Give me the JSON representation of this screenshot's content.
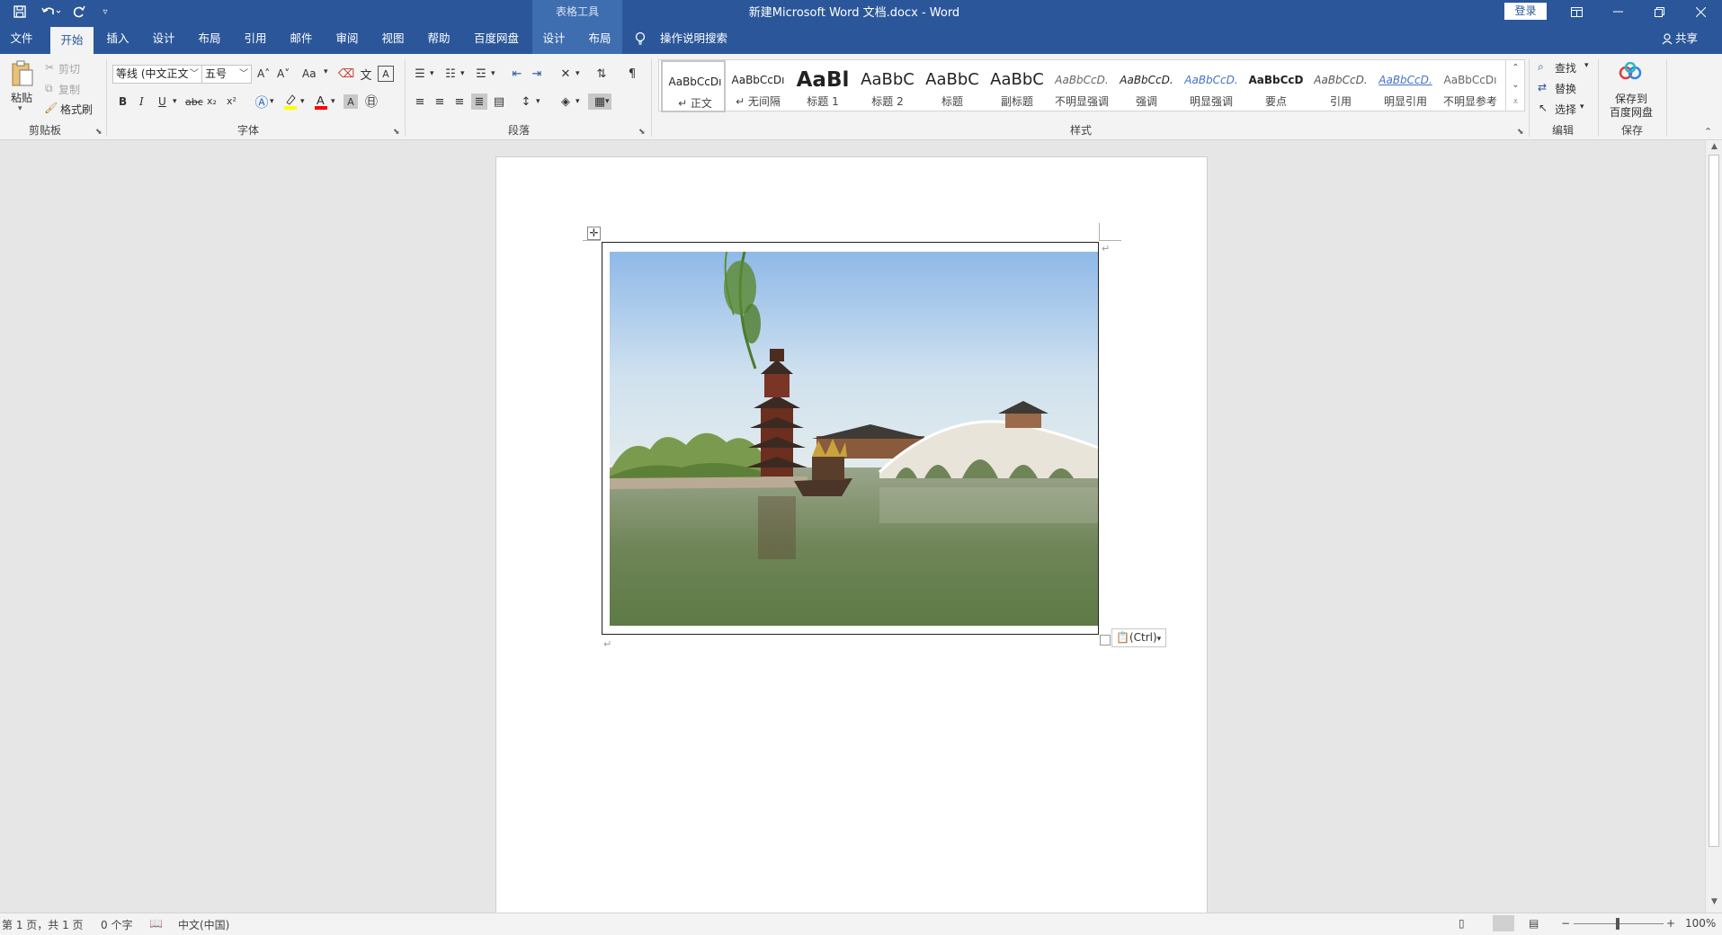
{
  "titlebar": {
    "context_tools_title": "表格工具",
    "document_title": "新建Microsoft Word 文档.docx  -  Word",
    "login_label": "登录",
    "qat_icons": [
      "save-icon",
      "undo-icon",
      "redo-icon",
      "customize-qat-icon"
    ],
    "window_buttons": [
      "ribbon-display-icon",
      "minimize-icon",
      "restore-icon",
      "close-icon"
    ]
  },
  "tabs": {
    "items": [
      {
        "label": "文件"
      },
      {
        "label": "开始"
      },
      {
        "label": "插入"
      },
      {
        "label": "设计"
      },
      {
        "label": "布局"
      },
      {
        "label": "引用"
      },
      {
        "label": "邮件"
      },
      {
        "label": "审阅"
      },
      {
        "label": "视图"
      },
      {
        "label": "帮助"
      },
      {
        "label": "百度网盘"
      },
      {
        "label": "设计"
      },
      {
        "label": "布局"
      }
    ],
    "active": "开始",
    "search_label": "操作说明搜索",
    "share_label": "共享"
  },
  "ribbon": {
    "clipboard": {
      "paste_label": "粘贴",
      "cut_label": "剪切",
      "copy_label": "复制",
      "format_painter_label": "格式刷",
      "group_label": "剪贴板"
    },
    "font": {
      "font_name": "等线 (中文正文",
      "font_size": "五号",
      "group_label": "字体",
      "btn_bold": "B",
      "btn_italic": "I",
      "btn_underline": "U",
      "btn_strike": "abc",
      "btn_sub": "x₂",
      "btn_sup": "x²",
      "btn_grow": "A˄",
      "btn_shrink": "A˅",
      "btn_case": "Aa",
      "font_color": "#ff0000",
      "highlight_color": "#ffff00"
    },
    "paragraph": {
      "group_label": "段落"
    },
    "styles": {
      "group_label": "样式",
      "items": [
        {
          "preview": "AaBbCcDı",
          "name": "↵ 正文"
        },
        {
          "preview": "AaBbCcDı",
          "name": "↵ 无间隔"
        },
        {
          "preview": "AaBl",
          "name": "标题 1"
        },
        {
          "preview": "AaBbC",
          "name": "标题 2"
        },
        {
          "preview": "AaBbC",
          "name": "标题"
        },
        {
          "preview": "AaBbC",
          "name": "副标题"
        },
        {
          "preview": "AaBbCcD.",
          "name": "不明显强调"
        },
        {
          "preview": "AaBbCcD.",
          "name": "强调"
        },
        {
          "preview": "AaBbCcD.",
          "name": "明显强调"
        },
        {
          "preview": "AaBbCcD",
          "name": "要点"
        },
        {
          "preview": "AaBbCcD.",
          "name": "引用"
        },
        {
          "preview": "AaBbCcD.",
          "name": "明显引用"
        },
        {
          "preview": "AaBbCcDı",
          "name": "不明显参考"
        }
      ]
    },
    "editing": {
      "find_label": "查找",
      "replace_label": "替换",
      "select_label": "选择",
      "group_label": "编辑"
    },
    "save": {
      "save_label": "保存到",
      "save_label2": "百度网盘",
      "group_label": "保存"
    }
  },
  "document": {
    "ctrl_tag": "(Ctrl)",
    "para_mark": "↵",
    "move_handle": "✛"
  },
  "status": {
    "page_info": "第 1 页，共 1 页",
    "word_count": "0 个字",
    "language": "中文(中国)",
    "zoom": "100%"
  }
}
